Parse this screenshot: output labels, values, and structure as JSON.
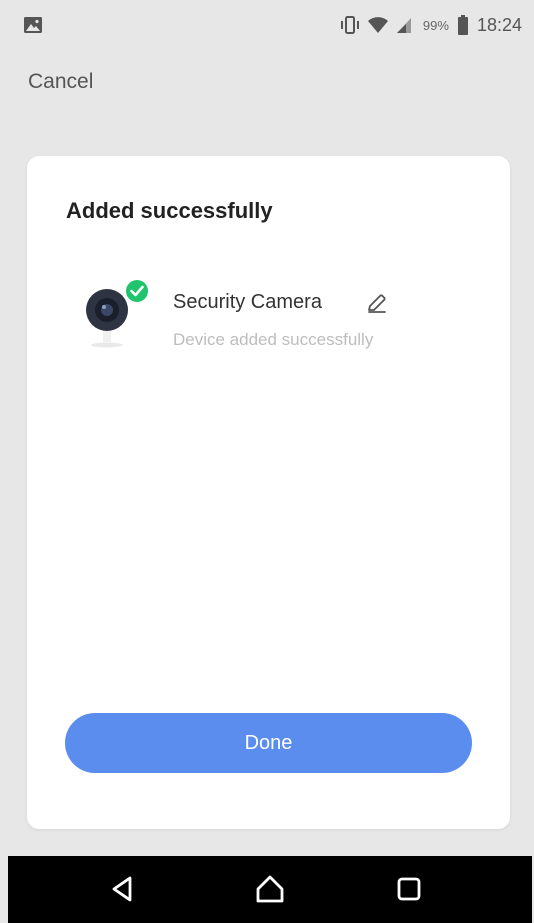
{
  "status_bar": {
    "battery_percent": "99%",
    "time": "18:24",
    "icons": [
      "image-icon",
      "vibrate-icon",
      "wifi-icon",
      "signal-icon",
      "battery-icon"
    ]
  },
  "header": {
    "cancel_label": "Cancel"
  },
  "card": {
    "title": "Added successfully",
    "device": {
      "name": "Security Camera",
      "status": "Device added successfully",
      "icon": "security-camera-icon",
      "badge_icon": "check-circle-icon"
    },
    "done_label": "Done"
  },
  "colors": {
    "background": "#e7e7e7",
    "card": "#ffffff",
    "accent": "#5b8def",
    "success": "#1fc46d",
    "nav_bar": "#000000"
  },
  "nav_bar": {
    "buttons": [
      "back-icon",
      "home-icon",
      "recent-apps-icon"
    ]
  }
}
